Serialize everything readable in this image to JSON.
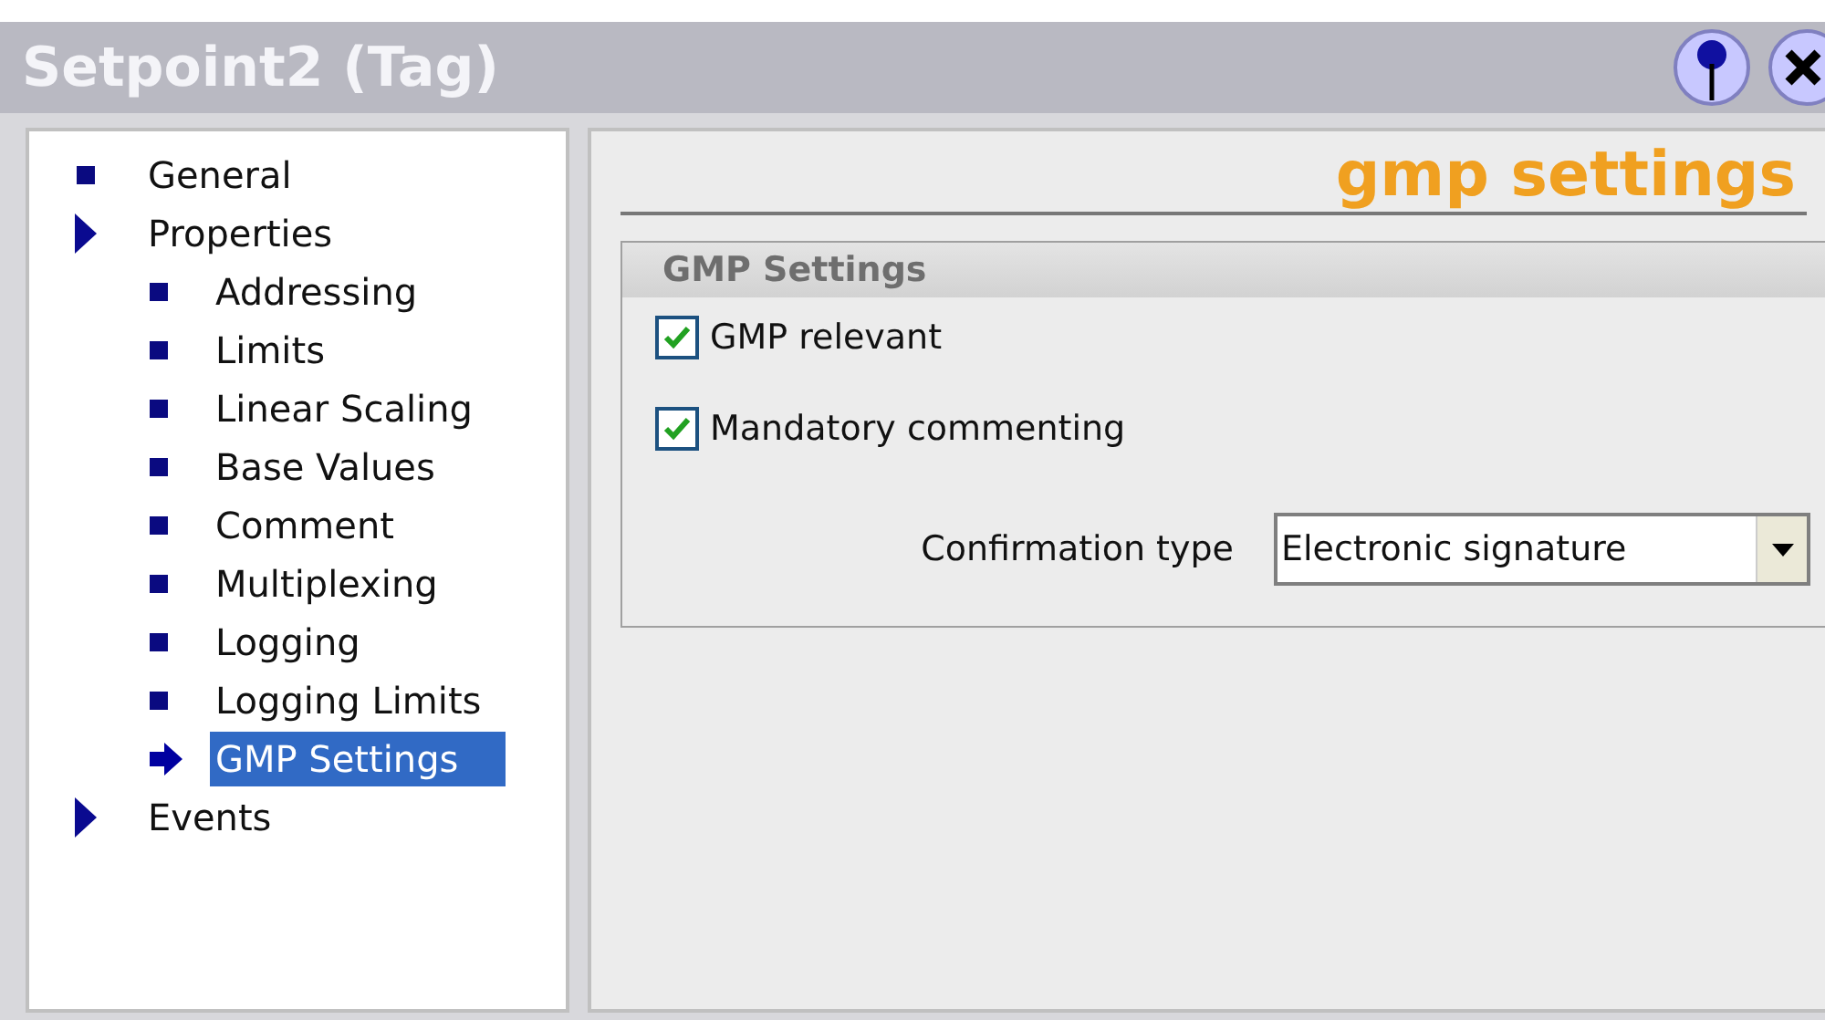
{
  "window": {
    "title": "Setpoint2 (Tag)"
  },
  "tree": [
    {
      "label": "General",
      "kind": "leaf",
      "selected": false
    },
    {
      "label": "Properties",
      "kind": "group",
      "selected": false,
      "children": [
        {
          "label": "Addressing",
          "kind": "leaf",
          "selected": false
        },
        {
          "label": "Limits",
          "kind": "leaf",
          "selected": false
        },
        {
          "label": "Linear Scaling",
          "kind": "leaf",
          "selected": false
        },
        {
          "label": "Base Values",
          "kind": "leaf",
          "selected": false
        },
        {
          "label": "Comment",
          "kind": "leaf",
          "selected": false
        },
        {
          "label": "Multiplexing",
          "kind": "leaf",
          "selected": false
        },
        {
          "label": "Logging",
          "kind": "leaf",
          "selected": false
        },
        {
          "label": "Logging Limits",
          "kind": "leaf",
          "selected": false
        },
        {
          "label": "GMP Settings",
          "kind": "leaf",
          "selected": true
        }
      ]
    },
    {
      "label": "Events",
      "kind": "group",
      "selected": false
    }
  ],
  "page": {
    "heading": "gmp settings",
    "group_title": "GMP Settings",
    "checkboxes": [
      {
        "label": "GMP relevant",
        "checked": true
      },
      {
        "label": "Mandatory commenting",
        "checked": true
      }
    ],
    "confirmation": {
      "label": "Confirmation type",
      "value": "Electronic signature"
    }
  }
}
